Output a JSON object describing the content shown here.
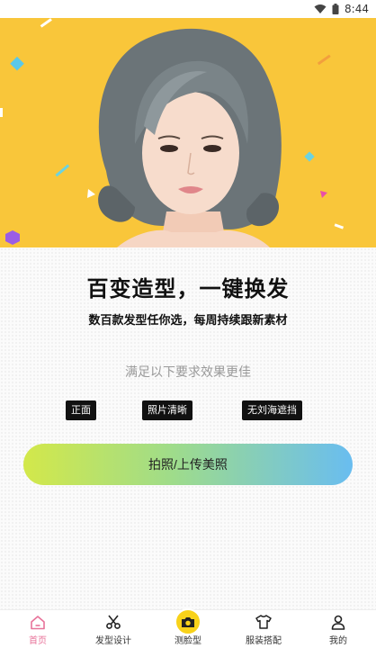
{
  "status_bar": {
    "time": "8:44"
  },
  "main": {
    "headline": "百变造型，一键换发",
    "subtitle": "数百款发型任你选，每周持续跟新素材",
    "requirements_title": "满足以下要求效果更佳",
    "requirements": [
      "正面",
      "照片清晰",
      "无刘海遮挡"
    ],
    "cta_label": "拍照/上传美照"
  },
  "tabbar": {
    "items": [
      {
        "label": "首页",
        "icon": "home-icon",
        "active": true
      },
      {
        "label": "发型设计",
        "icon": "scissors-icon",
        "active": false
      },
      {
        "label": "测脸型",
        "icon": "camera-icon",
        "active": false
      },
      {
        "label": "服装搭配",
        "icon": "tshirt-icon",
        "active": false
      },
      {
        "label": "我的",
        "icon": "user-icon",
        "active": false
      }
    ]
  },
  "colors": {
    "hero_background": "#f9c63a",
    "accent_yellow": "#f8d21a",
    "active_tab": "#e8739a",
    "tag_background": "#111111"
  }
}
